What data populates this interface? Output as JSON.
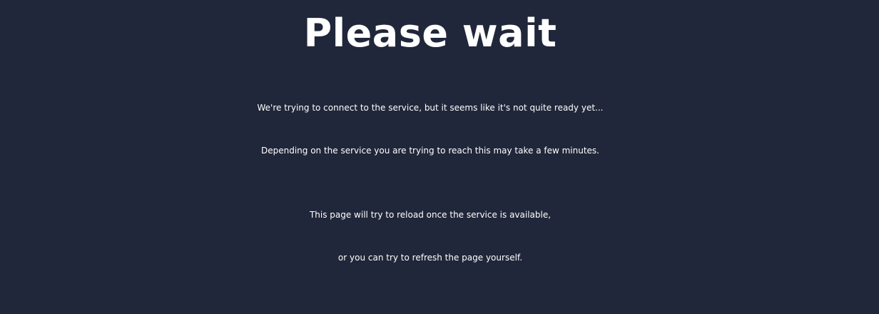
{
  "heading": "Please wait",
  "messages": {
    "line1": "We're trying to connect to the service, but it seems like it's not quite ready yet...",
    "line2": "Depending on the service you are trying to reach this may take a few minutes.",
    "line3": "This page will try to reload once the service is available,",
    "line4": "or you can try to refresh the page yourself."
  },
  "colors": {
    "background": "#21273a",
    "text": "#ffffff"
  }
}
